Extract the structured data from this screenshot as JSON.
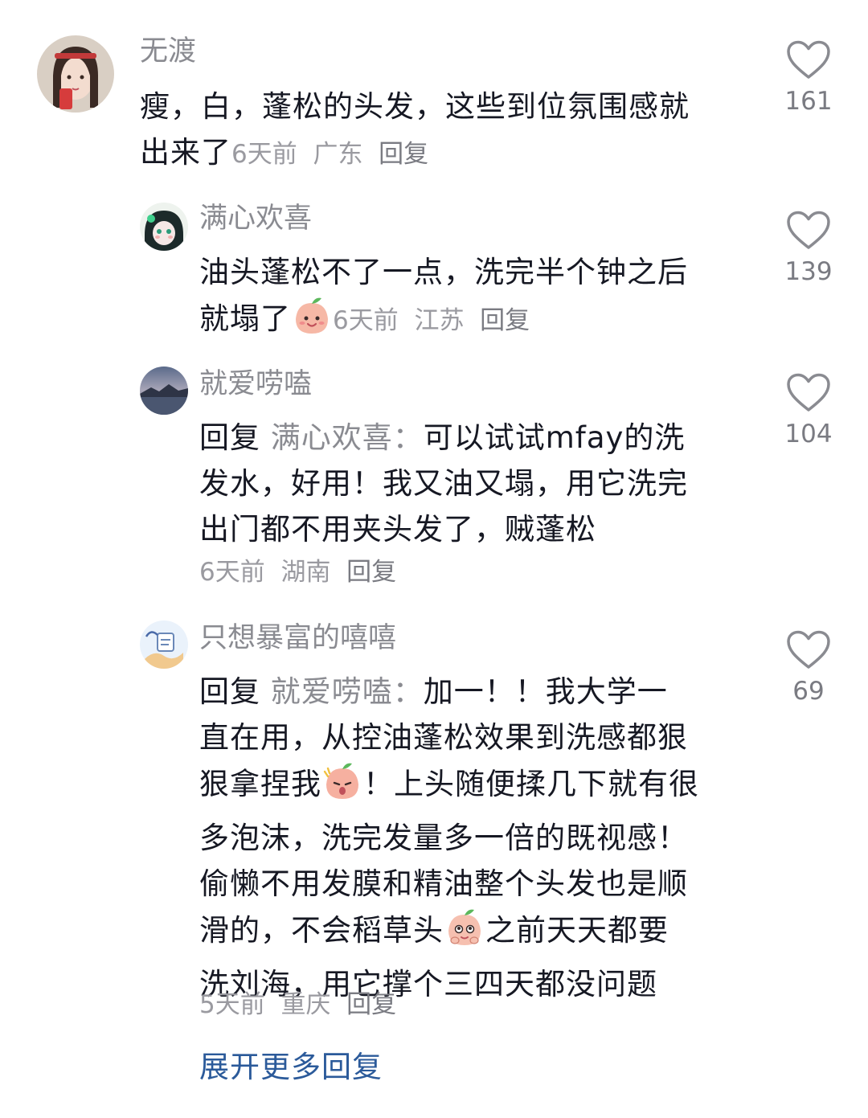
{
  "comments": [
    {
      "author": "无渡",
      "text_line1": "瘦，白，蓬松的头发，这些到位氛围感就",
      "text_line2": "出来了",
      "time": "6天前",
      "region": "广东",
      "reply_label": "回复",
      "likes": "161",
      "avatar_icon": "girl-avatar"
    },
    {
      "author": "满心欢喜",
      "text_line1": "油头蓬松不了一点，洗完半个钟之后",
      "text_line2": "就塌了",
      "time": "6天前",
      "region": "江苏",
      "reply_label": "回复",
      "likes": "139",
      "avatar_icon": "anime-avatar",
      "emoji": "peach-smile-emoji"
    },
    {
      "author": "就爱唠嗑",
      "reply_prefix": "回复",
      "reply_target": "满心欢喜：",
      "text_line1": "可以试试mfay的洗",
      "text_line2": "发水，好用！我又油又塌，用它洗完",
      "text_line3": "出门都不用夹头发了，贼蓬松",
      "time": "6天前",
      "region": "湖南",
      "reply_label": "回复",
      "likes": "104",
      "avatar_icon": "landscape-avatar"
    },
    {
      "author": "只想暴富的嘻嘻",
      "reply_prefix": "回复",
      "reply_target": "就爱唠嗑：",
      "text_line1": "加一！！我大学一",
      "text_line2": "直在用，从控油蓬松效果到洗感都狠",
      "text_line3a": "狠拿捏我",
      "text_line3b": "！上头随便揉几下就有很",
      "text_line4": "多泡沫，洗完发量多一倍的既视感！",
      "text_line5": "偷懒不用发膜和精油整个头发也是顺",
      "text_line6a": "滑的，不会稻草头",
      "text_line6b": "之前天天都要",
      "text_line7": "洗刘海，用它撑个三四天都没问题",
      "time": "5天前",
      "region": "重庆",
      "reply_label": "回复",
      "likes": "69",
      "avatar_icon": "sketch-avatar"
    }
  ],
  "more_replies_label": "展开更多回复",
  "colors": {
    "name_gray": "#8a8b91",
    "text_dark": "#161823",
    "meta_gray": "#9a9aa0",
    "link_blue": "#2b5a9a"
  }
}
